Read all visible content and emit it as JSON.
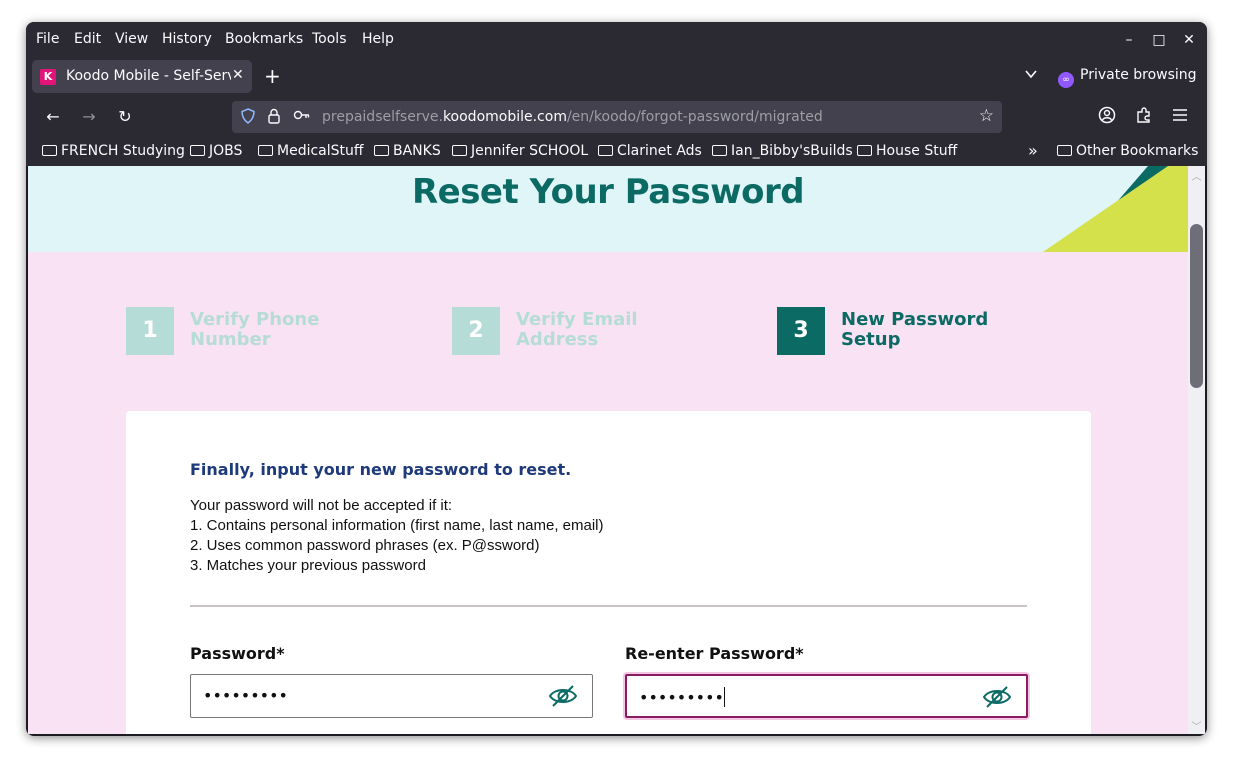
{
  "menubar": {
    "items": [
      "File",
      "Edit",
      "View",
      "History",
      "Bookmarks",
      "Tools",
      "Help"
    ],
    "minimize": "–",
    "maximize": "□",
    "close": "✕"
  },
  "tab": {
    "title": "Koodo Mobile - Self-Serve",
    "favicon": "K",
    "close": "✕"
  },
  "tabbar": {
    "new_tab": "+",
    "list_all": "⌄",
    "private_label": "Private browsing"
  },
  "navbar": {
    "back": "←",
    "forward": "→",
    "reload": "↻",
    "url_prefix": "prepaidselfserve.",
    "url_host": "koodomobile.com",
    "url_path": "/en/koodo/forgot-password/migrated",
    "bookmark_star": "☆",
    "account": "◎",
    "extensions": "⧉",
    "menu": "≡"
  },
  "bookmarks": {
    "items": [
      "FRENCH Studying",
      "JOBS",
      "MedicalStuff",
      "BANKS",
      "Jennifer SCHOOL",
      "Clarinet Ads",
      "Ian_Bibby'sBuilds",
      "House Stuff"
    ],
    "overflow": "»",
    "other": "Other Bookmarks"
  },
  "page": {
    "title": "Reset Your Password",
    "steps": [
      {
        "number": "1",
        "line1": "Verify Phone",
        "line2": "Number",
        "state": "inactive"
      },
      {
        "number": "2",
        "line1": "Verify Email",
        "line2": "Address",
        "state": "inactive"
      },
      {
        "number": "3",
        "line1": "New Password",
        "line2": "Setup",
        "state": "active"
      }
    ],
    "card_heading": "Finally, input your new password to reset.",
    "rules": [
      "Your password will not be accepted if it:",
      "1. Contains personal information (first name, last name, email)",
      "2. Uses common password phrases (ex. P@ssword)",
      "3. Matches your previous password"
    ],
    "password_label": "Password*",
    "password_value": "•••••••••",
    "reenter_label": "Re-enter Password*",
    "reenter_value": "•••••••••"
  },
  "colors": {
    "brand_teal": "#0b6a64",
    "brand_pink_bg": "#f9e2f3",
    "hero_bg": "#e0f5f8",
    "accent_lime": "#d4e14a",
    "heading_blue": "#1e3a7b"
  }
}
